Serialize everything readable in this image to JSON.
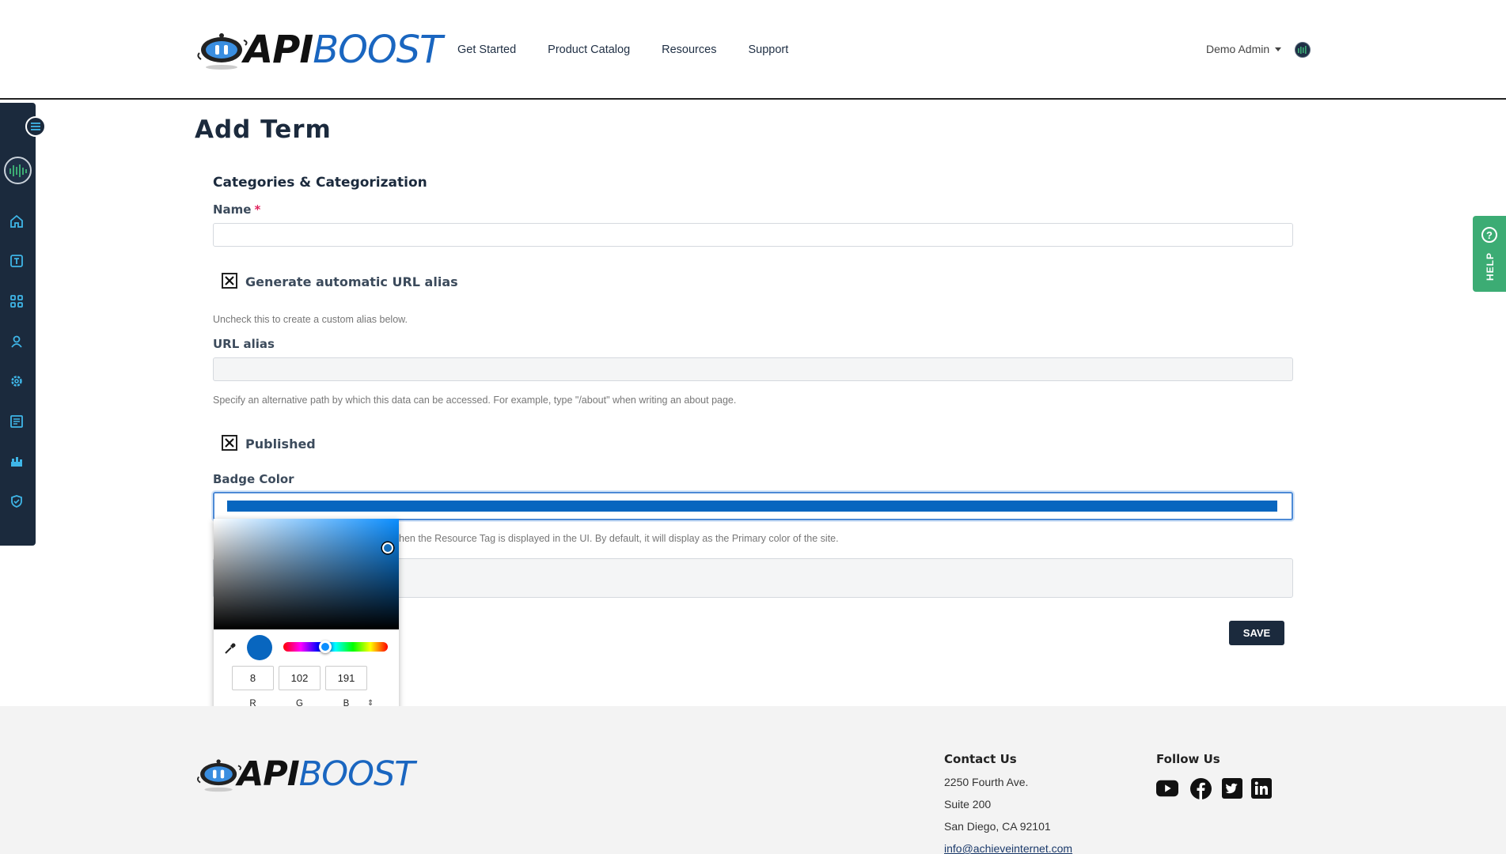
{
  "header": {
    "logo_api": "API",
    "logo_boost": "BOOST",
    "nav": [
      "Get Started",
      "Product Catalog",
      "Resources",
      "Support"
    ],
    "user_name": "Demo Admin"
  },
  "sidebar": {
    "icons": [
      "menu-icon",
      "home-icon",
      "text-icon",
      "grid-icon",
      "user-icon",
      "settings-icon",
      "content-icon",
      "structure-icon",
      "shield-icon"
    ]
  },
  "form": {
    "page_title": "Add Term",
    "section_title": "Categories & Categorization",
    "name_label": "Name",
    "name_required": "*",
    "name_value": "",
    "auto_alias_label": "Generate automatic URL alias",
    "auto_alias_checked": true,
    "auto_alias_help": "Uncheck this to create a custom alias below.",
    "url_alias_label": "URL alias",
    "url_alias_value": "",
    "url_alias_help": "Specify an alternative path by which this data can be accessed. For example, type \"/about\" when writing an about page.",
    "published_label": "Published",
    "published_checked": true,
    "badge_color_label": "Badge Color",
    "badge_color_value": "#0866bf",
    "badge_color_help": "hen the Resource Tag is displayed in the UI. By default, it will display as the Primary color of the site.",
    "save_label": "SAVE"
  },
  "color_picker": {
    "r": "8",
    "g": "102",
    "b": "191",
    "r_label": "R",
    "g_label": "G",
    "b_label": "B",
    "mode_toggle": "⇕"
  },
  "help_tab": {
    "label": "HELP"
  },
  "footer": {
    "logo_api": "API",
    "logo_boost": "BOOST",
    "contact_heading": "Contact Us",
    "address_line1": "2250 Fourth Ave.",
    "address_line2": "Suite 200",
    "address_line3": "San Diego, CA 92101",
    "email": "info@achieveinternet.com",
    "follow_heading": "Follow Us",
    "social": [
      "youtube-icon",
      "facebook-icon",
      "twitter-icon",
      "linkedin-icon"
    ]
  },
  "colors": {
    "navy": "#1b2a3d",
    "brand_blue": "#1a66c0",
    "help_green": "#3cac74",
    "picked": "#0866bf"
  }
}
